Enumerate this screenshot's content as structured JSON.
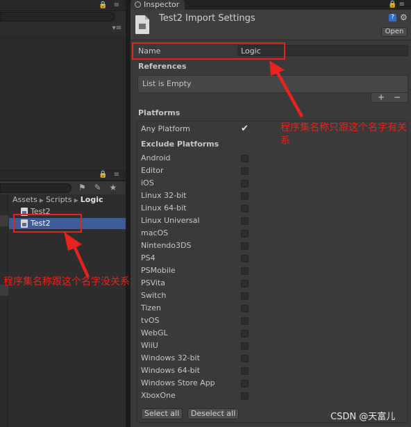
{
  "inspector": {
    "tab_label": "Inspector",
    "title": "Test2 Import Settings",
    "open_label": "Open",
    "help_glyph": "?",
    "gear_glyph": "⚙",
    "name_label": "Name",
    "name_value": "Logic",
    "references_heading": "References",
    "list_empty_text": "List is Empty",
    "add_glyph": "+",
    "remove_glyph": "−",
    "platforms_heading": "Platforms",
    "any_platform_label": "Any Platform",
    "any_platform_checked": true,
    "exclude_heading": "Exclude Platforms",
    "exclude_platforms": [
      {
        "label": "Android",
        "checked": false
      },
      {
        "label": "Editor",
        "checked": false
      },
      {
        "label": "iOS",
        "checked": false
      },
      {
        "label": "Linux 32-bit",
        "checked": false
      },
      {
        "label": "Linux 64-bit",
        "checked": false
      },
      {
        "label": "Linux Universal",
        "checked": false
      },
      {
        "label": "macOS",
        "checked": false
      },
      {
        "label": "Nintendo3DS",
        "checked": false
      },
      {
        "label": "PS4",
        "checked": false
      },
      {
        "label": "PSMobile",
        "checked": false
      },
      {
        "label": "PSVita",
        "checked": false
      },
      {
        "label": "Switch",
        "checked": false
      },
      {
        "label": "Tizen",
        "checked": false
      },
      {
        "label": "tvOS",
        "checked": false
      },
      {
        "label": "WebGL",
        "checked": false
      },
      {
        "label": "WiiU",
        "checked": false
      },
      {
        "label": "Windows 32-bit",
        "checked": false
      },
      {
        "label": "Windows 64-bit",
        "checked": false
      },
      {
        "label": "Windows Store App",
        "checked": false
      },
      {
        "label": "XboxOne",
        "checked": false
      }
    ],
    "select_all_label": "Select all",
    "deselect_all_label": "Deselect all"
  },
  "project": {
    "breadcrumb": [
      "Assets",
      "Scripts",
      "Logic"
    ],
    "assets": [
      {
        "label": "Test2",
        "selected": false
      },
      {
        "label": "Test2",
        "selected": true
      }
    ],
    "panel_icons": "🔒 ≡",
    "toolbar_icons": "⚑ ✎ ★"
  },
  "annotations": {
    "top_note": "程序集名称只跟这个名字有关系",
    "bottom_note": "程序集名称跟这个名字没关系",
    "color": "#e8231d"
  },
  "watermark": "CSDN @天富儿"
}
